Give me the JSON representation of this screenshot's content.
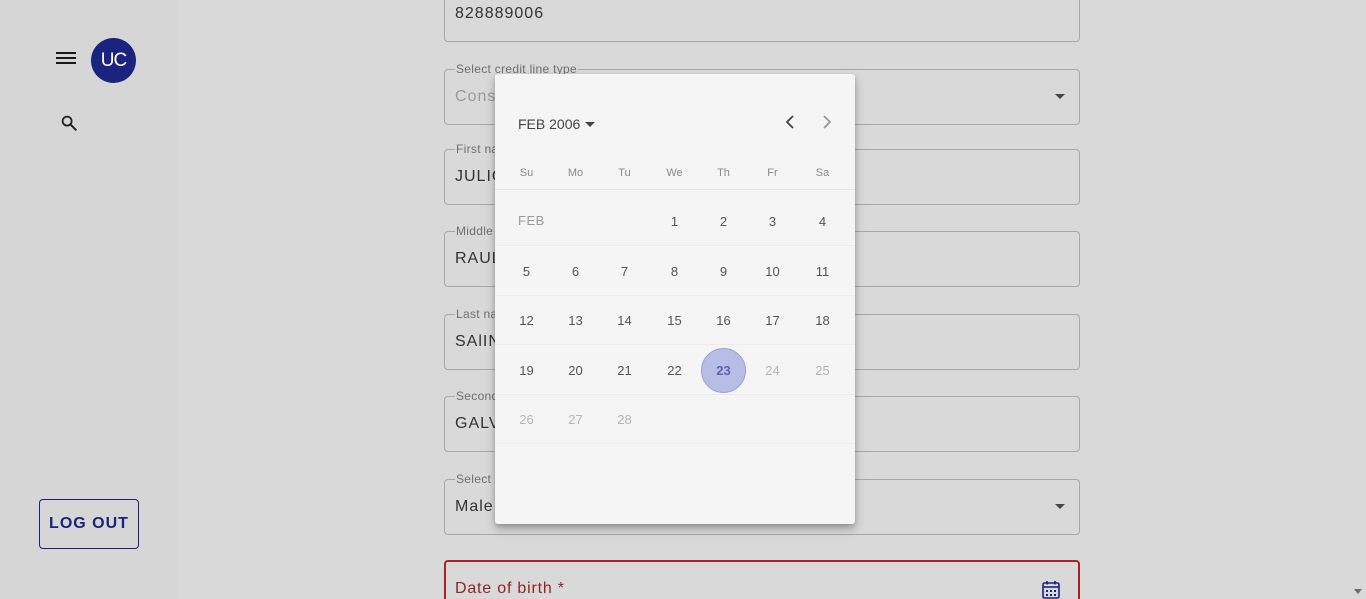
{
  "sidebar": {
    "avatar_initials": "UC",
    "logout_label": "LOG OUT"
  },
  "form": {
    "top_field_value": "828889006",
    "credit_line": {
      "label": "Select credit line type",
      "value": "Consumer credit line"
    },
    "first_name": {
      "label": "First name *",
      "value": "JULIO"
    },
    "middle_name": {
      "label": "Middle name",
      "value": "RAUL"
    },
    "last_name": {
      "label": "Last name",
      "value": "SAlINAS"
    },
    "second_last_name": {
      "label": "Second last name",
      "value": "GALVEZ"
    },
    "gender": {
      "label": "Select gender *",
      "value": "Male"
    },
    "date_of_birth": {
      "label": "Date of birth *"
    }
  },
  "datepicker": {
    "header": "FEB 2006",
    "month_label": "FEB",
    "weekdays": [
      "Su",
      "Mo",
      "Tu",
      "We",
      "Th",
      "Fr",
      "Sa"
    ],
    "weeks": [
      [
        null,
        null,
        null,
        "1",
        "2",
        "3",
        "4"
      ],
      [
        "5",
        "6",
        "7",
        "8",
        "9",
        "10",
        "11"
      ],
      [
        "12",
        "13",
        "14",
        "15",
        "16",
        "17",
        "18"
      ],
      [
        "19",
        "20",
        "21",
        "22",
        "23",
        "24",
        "25"
      ],
      [
        "26",
        "27",
        "28",
        null,
        null,
        null,
        null
      ]
    ],
    "selected": "23",
    "disabled_from": 24
  },
  "colors": {
    "primary": "#1a237e",
    "error": "#a52424",
    "selected_day_bg": "#b8bde6"
  }
}
